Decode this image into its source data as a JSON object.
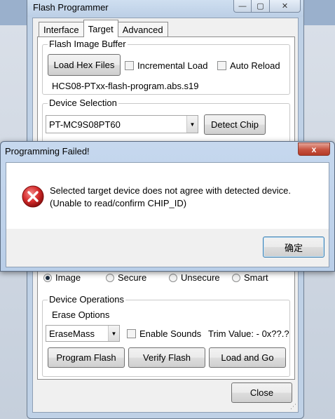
{
  "main_window": {
    "title": "Flash Programmer",
    "caption_buttons": {
      "minimize_glyph": "—",
      "maximize_glyph": "▢",
      "close_glyph": "✕"
    },
    "tabs": [
      {
        "label": "Interface",
        "active": false
      },
      {
        "label": "Target",
        "active": true
      },
      {
        "label": "Advanced",
        "active": false
      }
    ],
    "flash_image_buffer": {
      "title": "Flash Image Buffer",
      "load_button": "Load Hex Files",
      "incremental_load": {
        "label": "Incremental Load",
        "checked": false
      },
      "auto_reload": {
        "label": "Auto Reload",
        "checked": false
      },
      "file_name": "HCS08-PTxx-flash-program.abs.s19"
    },
    "device_selection": {
      "title": "Device Selection",
      "device_value": "PT-MC9S08PT60",
      "detect_button": "Detect Chip"
    },
    "mode_options": [
      {
        "label": "Image",
        "selected": true
      },
      {
        "label": "Secure",
        "selected": false
      },
      {
        "label": "Unsecure",
        "selected": false
      },
      {
        "label": "Smart",
        "selected": false
      }
    ],
    "device_operations": {
      "title": "Device Operations",
      "erase_options_label": "Erase Options",
      "erase_value": "EraseMass",
      "enable_sounds": {
        "label": "Enable Sounds",
        "checked": false
      },
      "trim_value": "Trim Value: - 0x??.?",
      "program_button": "Program Flash",
      "verify_button": "Verify Flash",
      "load_go_button": "Load and Go"
    },
    "close_button": "Close"
  },
  "dialog": {
    "title": "Programming Failed!",
    "close_glyph": "x",
    "icon": "error-icon",
    "message_line1": "Selected target device does not agree with detected device.",
    "message_line2": "(Unable to read/confirm CHIP_ID)",
    "ok_button": "确定",
    "colors": {
      "error_red": "#d42a2a",
      "close_red": "#c7523f"
    }
  }
}
